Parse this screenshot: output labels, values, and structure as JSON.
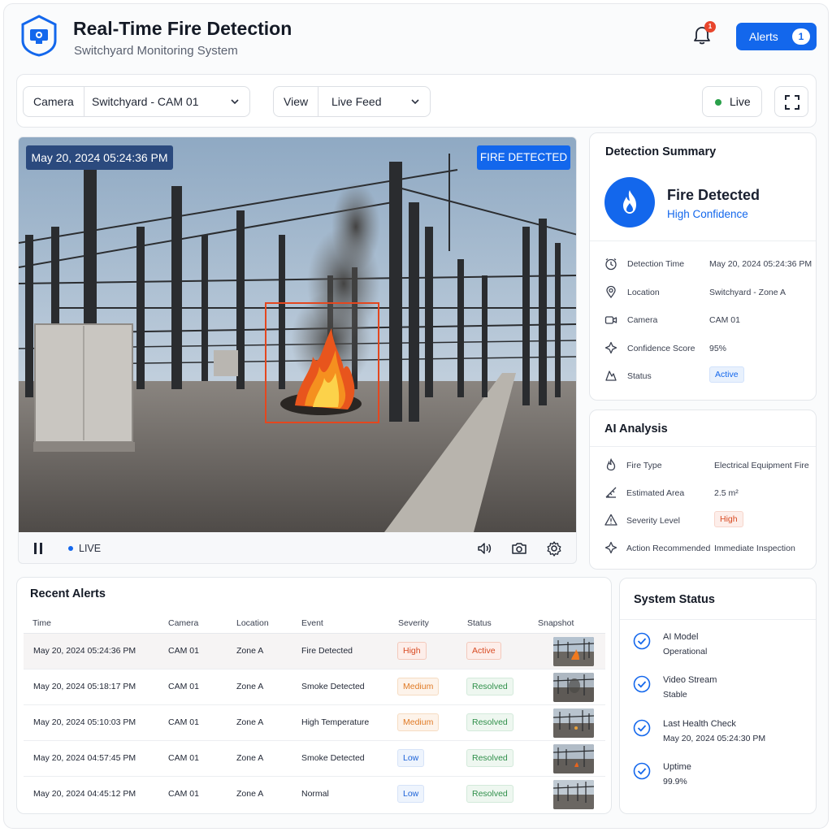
{
  "header": {
    "title": "Real-Time Fire Detection",
    "subtitle": "Switchyard Monitoring System",
    "notification_count": "1",
    "alerts_label": "Alerts",
    "alerts_count": "1"
  },
  "toolbar": {
    "camera_label": "Camera",
    "camera_value": "Switchyard - CAM 01",
    "view_label": "View",
    "view_value": "Live Feed",
    "live_label": "Live"
  },
  "video": {
    "timestamp": "May 20, 2024 05:24:36 PM",
    "fire_tag": "FIRE DETECTED",
    "live_text": "LIVE"
  },
  "detection_summary": {
    "title": "Detection Summary",
    "status_title": "Fire Detected",
    "confidence_text": "High Confidence",
    "rows": [
      {
        "label": "Detection Time",
        "value": "May 20, 2024 05:24:36 PM",
        "icon": "clock-icon"
      },
      {
        "label": "Location",
        "value": "Switchyard - Zone A",
        "icon": "location-pin-icon"
      },
      {
        "label": "Camera",
        "value": "CAM 01",
        "icon": "camera-icon"
      },
      {
        "label": "Confidence Score",
        "value": "95%",
        "icon": "target-icon"
      },
      {
        "label": "Status",
        "value": "Active",
        "icon": "status-icon"
      }
    ]
  },
  "ai_analysis": {
    "title": "AI Analysis",
    "rows": [
      {
        "label": "Fire Type",
        "value": "Electrical Equipment Fire",
        "icon": "flame-outline-icon"
      },
      {
        "label": "Estimated Area",
        "value": "2.5 m²",
        "icon": "area-ruler-icon"
      },
      {
        "label": "Severity Level",
        "value": "High",
        "icon": "warning-triangle-icon"
      },
      {
        "label": "Action Recommended",
        "value": "Immediate Inspection",
        "icon": "action-icon"
      }
    ]
  },
  "recent_alerts": {
    "title": "Recent Alerts",
    "columns": [
      "Time",
      "Camera",
      "Location",
      "Event",
      "Severity",
      "Status",
      "Snapshot"
    ],
    "rows": [
      {
        "time": "May 20, 2024 05:24:36 PM",
        "camera": "CAM 01",
        "location": "Zone A",
        "event": "Fire Detected",
        "severity": "High",
        "status": "Active"
      },
      {
        "time": "May 20, 2024 05:18:17 PM",
        "camera": "CAM 01",
        "location": "Zone A",
        "event": "Smoke Detected",
        "severity": "Medium",
        "status": "Resolved"
      },
      {
        "time": "May 20, 2024 05:10:03 PM",
        "camera": "CAM 01",
        "location": "Zone A",
        "event": "High Temperature",
        "severity": "Medium",
        "status": "Resolved"
      },
      {
        "time": "May 20, 2024 04:57:45 PM",
        "camera": "CAM 01",
        "location": "Zone A",
        "event": "Smoke Detected",
        "severity": "Low",
        "status": "Resolved"
      },
      {
        "time": "May 20, 2024 04:45:12 PM",
        "camera": "CAM 01",
        "location": "Zone A",
        "event": "Normal",
        "severity": "Low",
        "status": "Resolved"
      }
    ]
  },
  "system_status": {
    "title": "System Status",
    "items": [
      {
        "label": "AI Model",
        "value": "Operational"
      },
      {
        "label": "Video Stream",
        "value": "Stable"
      },
      {
        "label": "Last Health Check",
        "value": "May 20, 2024 05:24:30 PM"
      },
      {
        "label": "Uptime",
        "value": "99.9%"
      }
    ]
  },
  "colors": {
    "accent": "#1367ec",
    "danger": "#e8452c",
    "success": "#2aa04a",
    "bounding_box": "#e4471f"
  }
}
